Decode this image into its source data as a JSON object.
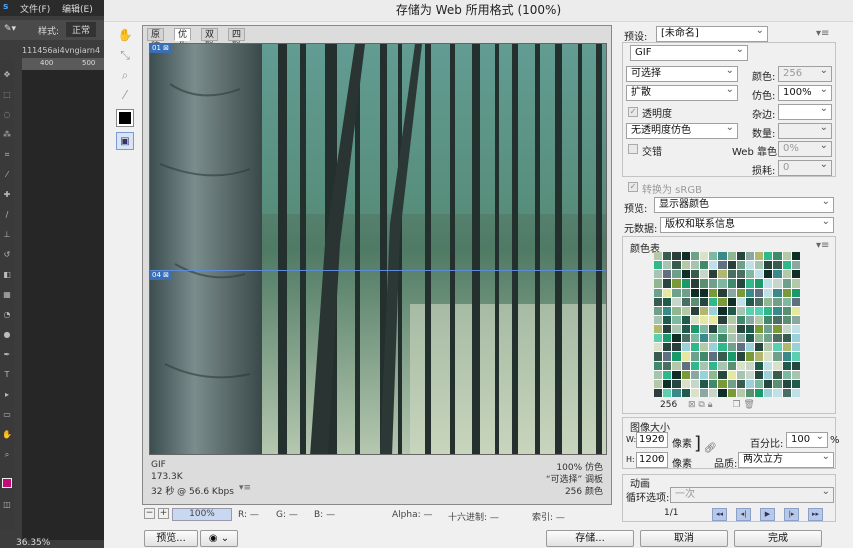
{
  "ps": {
    "app_logo": "s",
    "menu": [
      "文件(F)",
      "编辑(E)"
    ],
    "style_label": "样式:",
    "style_value": "正常",
    "tab_name": "111456ai4vngiarn4",
    "ruler": [
      "400",
      "500"
    ],
    "zoom": "36.35%"
  },
  "dialog": {
    "title": "存储为 Web 所用格式 (100%)",
    "tabs": [
      "原稿",
      "优化",
      "双联",
      "四联"
    ],
    "slices": [
      "01",
      "04"
    ],
    "image_info_left": [
      "GIF",
      "173.3K",
      "32 秒 @ 56.6 Kbps"
    ],
    "image_info_right": [
      "100% 仿色",
      "“可选择” 调板",
      "256 颜色"
    ],
    "status": {
      "zoom": "100%",
      "r": "R: —",
      "g": "G: —",
      "b": "B: —",
      "alpha": "Alpha: —",
      "hex": "十六进制: —",
      "index": "索引: —"
    },
    "buttons": {
      "preview": "预览...",
      "save": "存储...",
      "cancel": "取消",
      "done": "完成"
    }
  },
  "settings": {
    "preset_label": "预设:",
    "preset_value": "[未命名]",
    "format": "GIF",
    "reduction": "可选择",
    "colors_label": "颜色:",
    "colors_value": "256",
    "dither_algo": "扩散",
    "dither_label": "仿色:",
    "dither_value": "100%",
    "transparency_label": "透明度",
    "matte_label": "杂边:",
    "trans_dither": "无透明度仿色",
    "amount_label": "数量:",
    "interlaced_label": "交错",
    "web_snap_label": "Web 靠色:",
    "web_snap_value": "0%",
    "lossy_label": "损耗:",
    "lossy_value": "0",
    "convert_srgb": "转换为 sRGB",
    "preview_label": "预览:",
    "preview_value": "显示器颜色",
    "metadata_label": "元数据:",
    "metadata_value": "版权和联系信息",
    "color_table_title": "颜色表",
    "color_count": "256",
    "image_size_title": "图像大小",
    "w_label": "W:",
    "w_value": "1920",
    "h_label": "H:",
    "h_value": "1200",
    "px_unit": "像素",
    "percent_label": "百分比:",
    "percent_value": "100",
    "percent_unit": "%",
    "quality_label": "品质:",
    "quality_value": "两次立方",
    "anim_title": "动画",
    "loop_label": "循环选项:",
    "loop_value": "一次",
    "frame_counter": "1/1"
  },
  "colors": {
    "accent": "#3b6fb4",
    "palette": [
      "#1f5a4a",
      "#3f8a6a",
      "#7fb8a0",
      "#2a3e3a",
      "#a7c4b0",
      "#5b8f72",
      "#0f2e26",
      "#8aa8a0",
      "#c6d6c8",
      "#4a6e62",
      "#25473d",
      "#6fa08a",
      "#b3c9a8",
      "#d9e2c8",
      "#385c4e",
      "#90b890",
      "#1a9a6a",
      "#2fb88a",
      "#5ad0b0",
      "#7a9a3a",
      "#b0b870",
      "#e4e8a0",
      "#3a8a8a",
      "#9ad0d8",
      "#c0e0e8",
      "#607080"
    ]
  }
}
